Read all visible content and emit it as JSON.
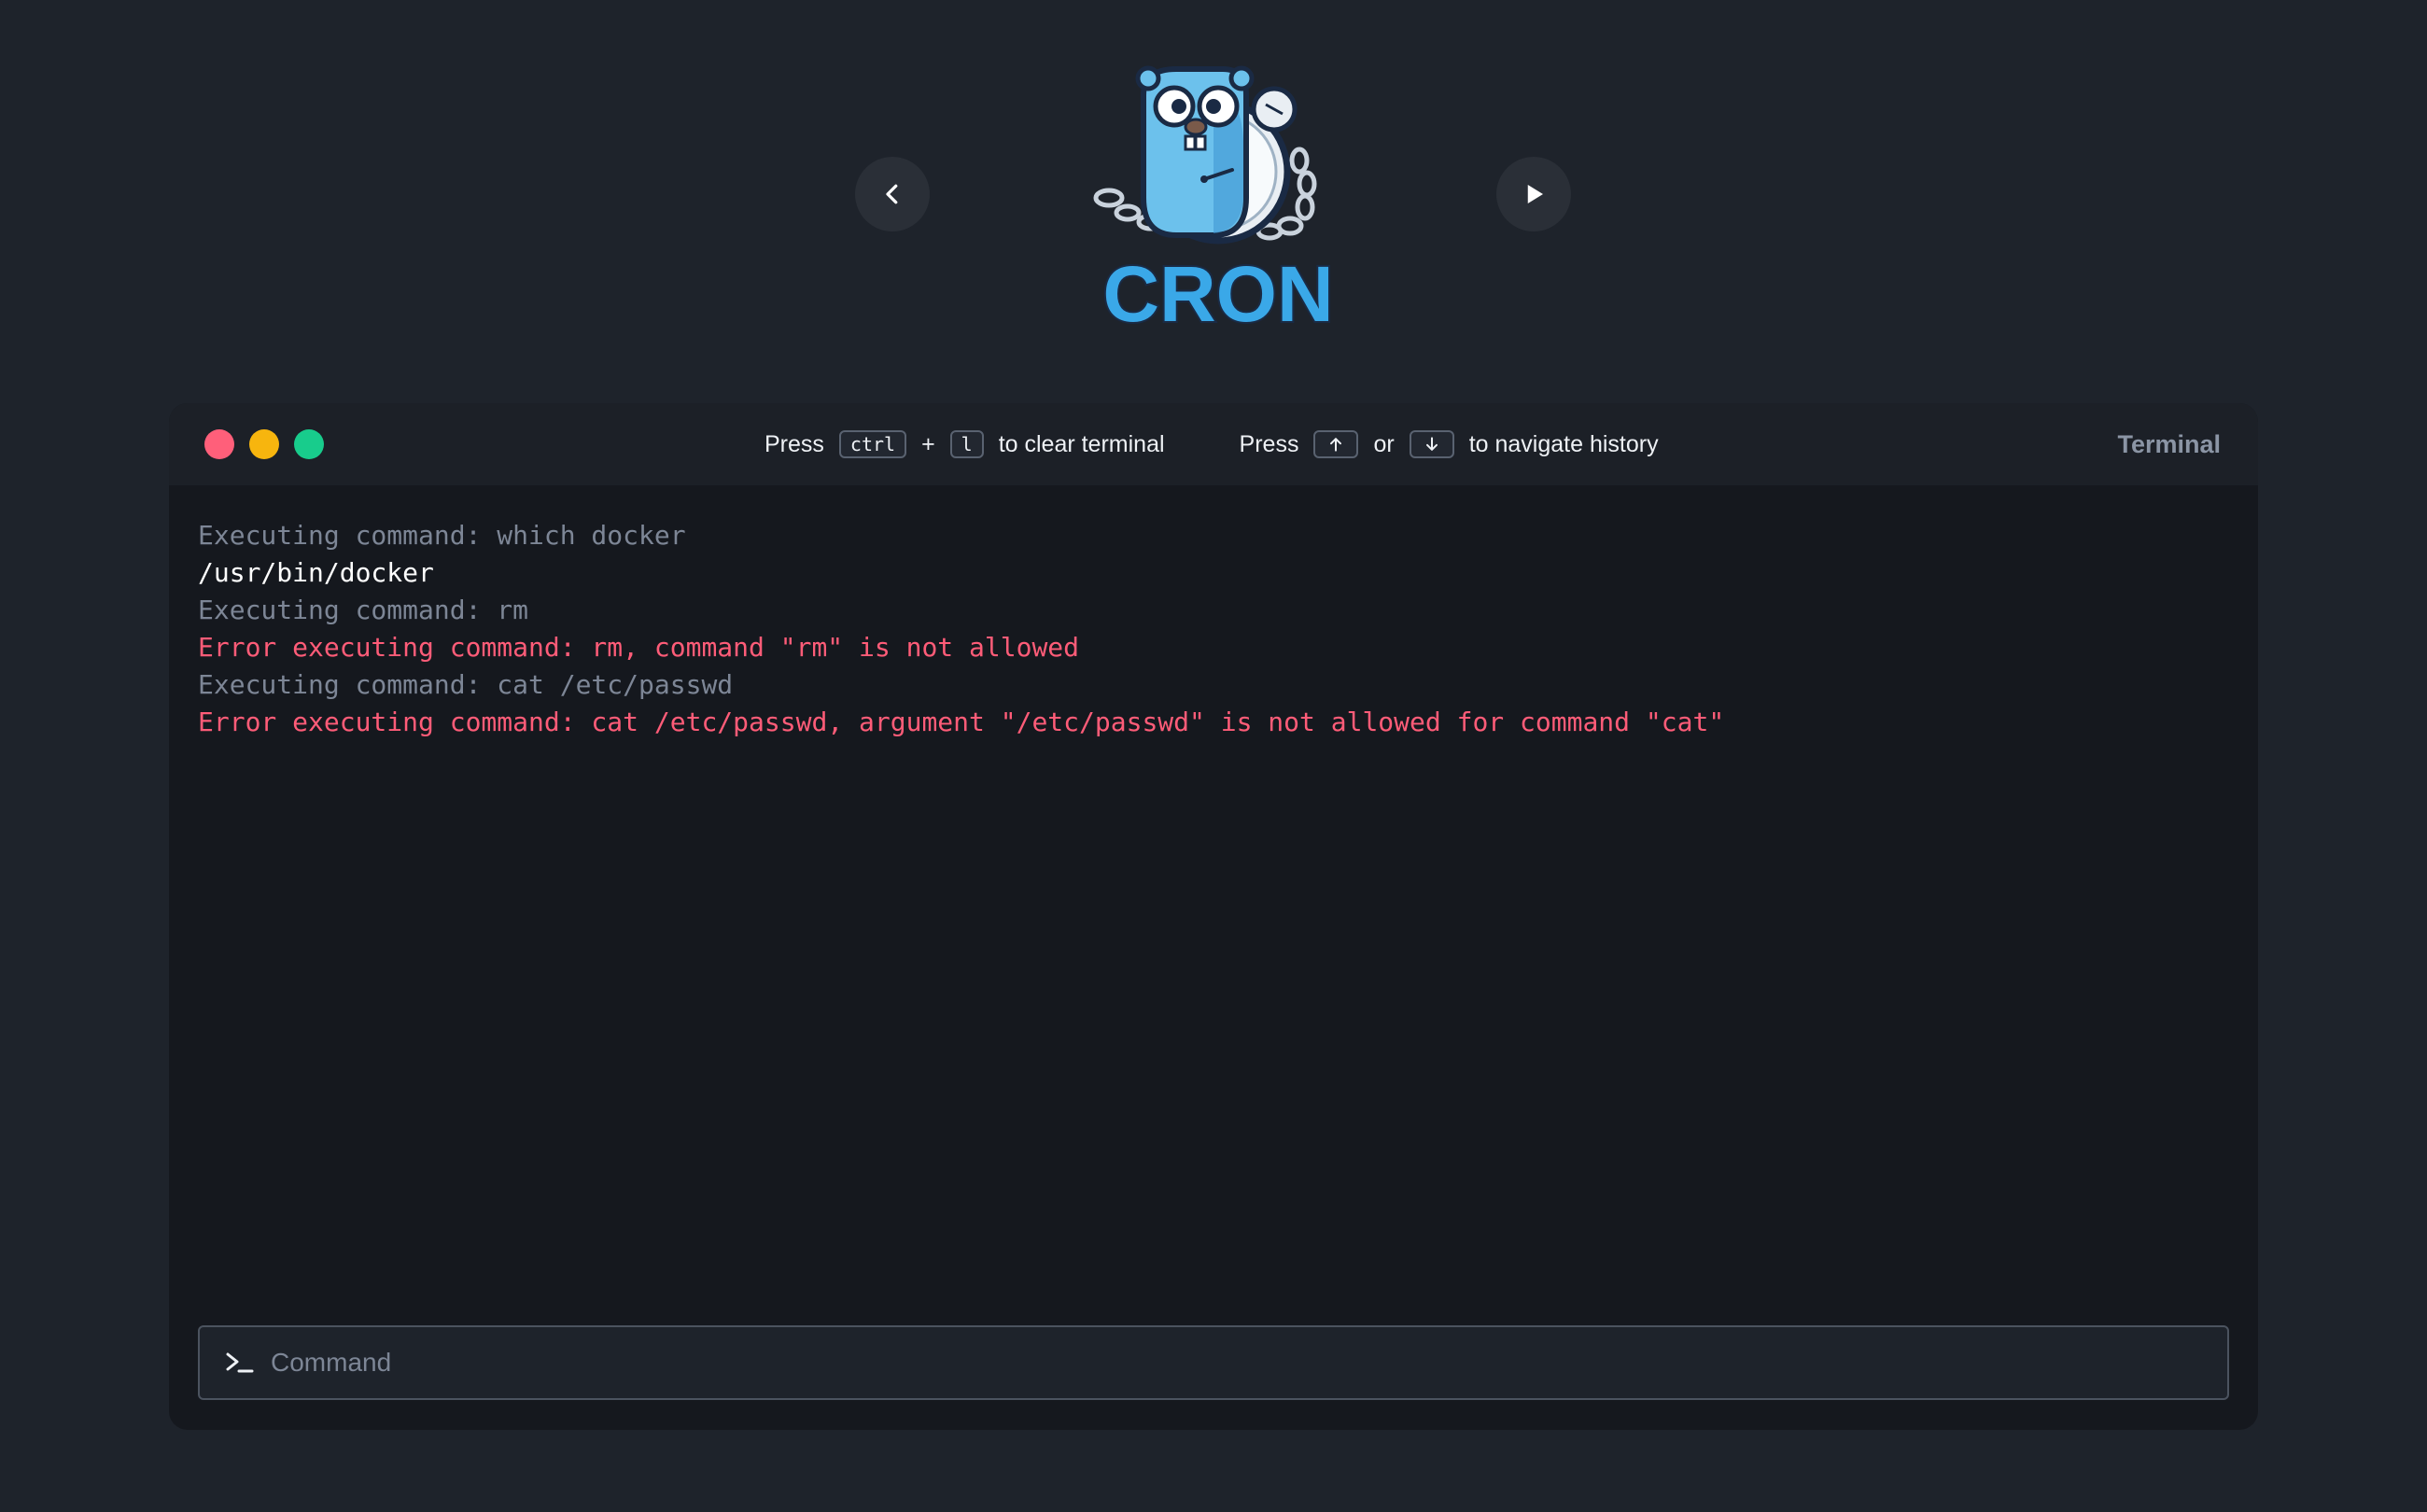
{
  "header": {
    "back_icon": "chevron-left-icon",
    "play_icon": "play-icon",
    "logo_text": "CRON",
    "logo_colors": {
      "body": "#5fb8e8",
      "accent": "#3a8fd0",
      "outline": "#1a2a44"
    }
  },
  "terminal": {
    "window_dots": [
      "#ff5f7a",
      "#f7b50e",
      "#18cc8c"
    ],
    "title": "Terminal",
    "hints": {
      "clear": {
        "press": "Press",
        "key1": "ctrl",
        "plus": "+",
        "key2": "l",
        "suffix": "to clear terminal"
      },
      "history": {
        "press": "Press",
        "up_icon": "arrow-up-icon",
        "or": "or",
        "down_icon": "arrow-down-icon",
        "suffix": "to navigate history"
      }
    },
    "lines": [
      {
        "type": "cmd",
        "text": "Executing command: which docker"
      },
      {
        "type": "out",
        "text": "/usr/bin/docker"
      },
      {
        "type": "cmd",
        "text": "Executing command: rm"
      },
      {
        "type": "err",
        "text": "Error executing command: rm, command \"rm\" is not allowed"
      },
      {
        "type": "cmd",
        "text": "Executing command: cat /etc/passwd"
      },
      {
        "type": "err",
        "text": "Error executing command: cat /etc/passwd, argument \"/etc/passwd\" is not allowed for command \"cat\""
      }
    ],
    "input": {
      "placeholder": "Command",
      "value": "",
      "icon": "terminal-prompt-icon"
    },
    "colors": {
      "cmd": "#7d8696",
      "out": "#ffffff",
      "err": "#ff5c78"
    }
  }
}
